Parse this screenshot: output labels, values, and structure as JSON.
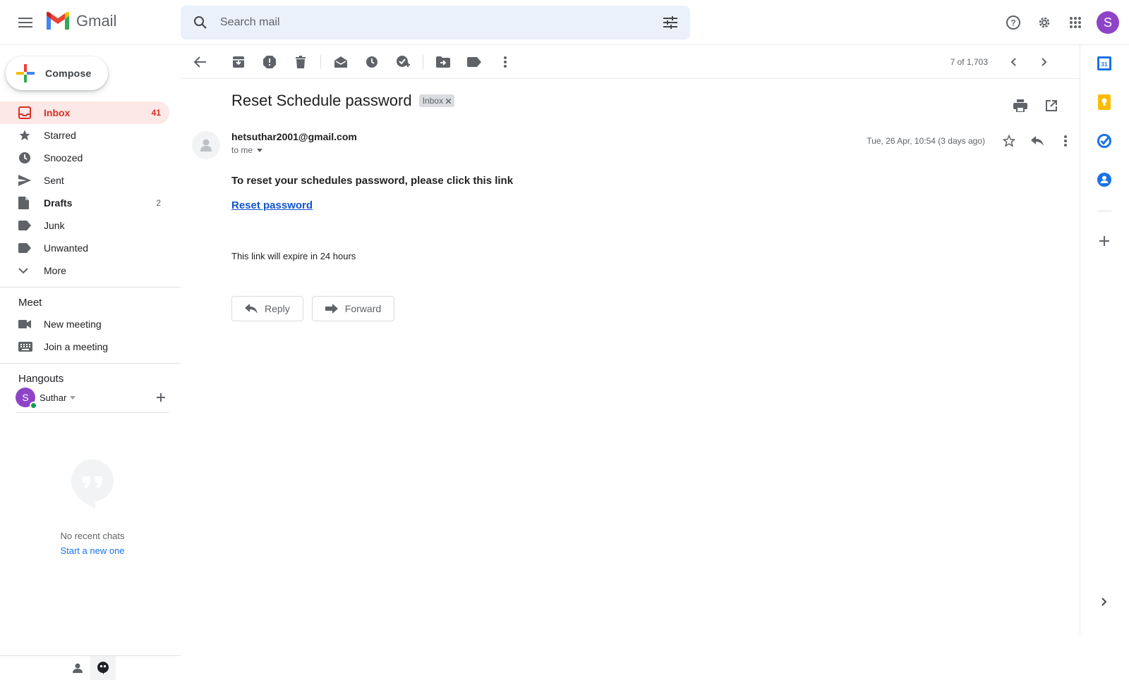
{
  "app": {
    "name": "Gmail"
  },
  "search": {
    "placeholder": "Search mail"
  },
  "account": {
    "initial": "S"
  },
  "compose": {
    "label": "Compose"
  },
  "sidebar": {
    "items": [
      {
        "label": "Inbox",
        "count": "41"
      },
      {
        "label": "Starred",
        "count": ""
      },
      {
        "label": "Snoozed",
        "count": ""
      },
      {
        "label": "Sent",
        "count": ""
      },
      {
        "label": "Drafts",
        "count": "2"
      },
      {
        "label": "Junk",
        "count": ""
      },
      {
        "label": "Unwanted",
        "count": ""
      },
      {
        "label": "More",
        "count": ""
      }
    ],
    "meet": {
      "title": "Meet",
      "items": [
        {
          "label": "New meeting"
        },
        {
          "label": "Join a meeting"
        }
      ]
    },
    "hangouts": {
      "title": "Hangouts",
      "user": {
        "initial": "S",
        "name": "Suthar"
      },
      "empty_text": "No recent chats",
      "start_link": "Start a new one"
    }
  },
  "toolbar": {
    "pager_text": "7 of 1,703"
  },
  "email": {
    "subject": "Reset Schedule password",
    "label_chip": "Inbox",
    "sender": "hetsuthar2001@gmail.com",
    "to": "to me",
    "date": "Tue, 26 Apr, 10:54 (3 days ago)",
    "body_lead": "To reset your schedules password, please click this link",
    "body_link": "Reset password",
    "body_expiry": "This link will expire in 24 hours"
  },
  "actions": {
    "reply": "Reply",
    "forward": "Forward"
  },
  "colors": {
    "accent_red": "#d93025",
    "accent_blue": "#1a73e8",
    "avatar_purple": "#8e44c7",
    "inbox_highlight": "#fce8e6"
  }
}
